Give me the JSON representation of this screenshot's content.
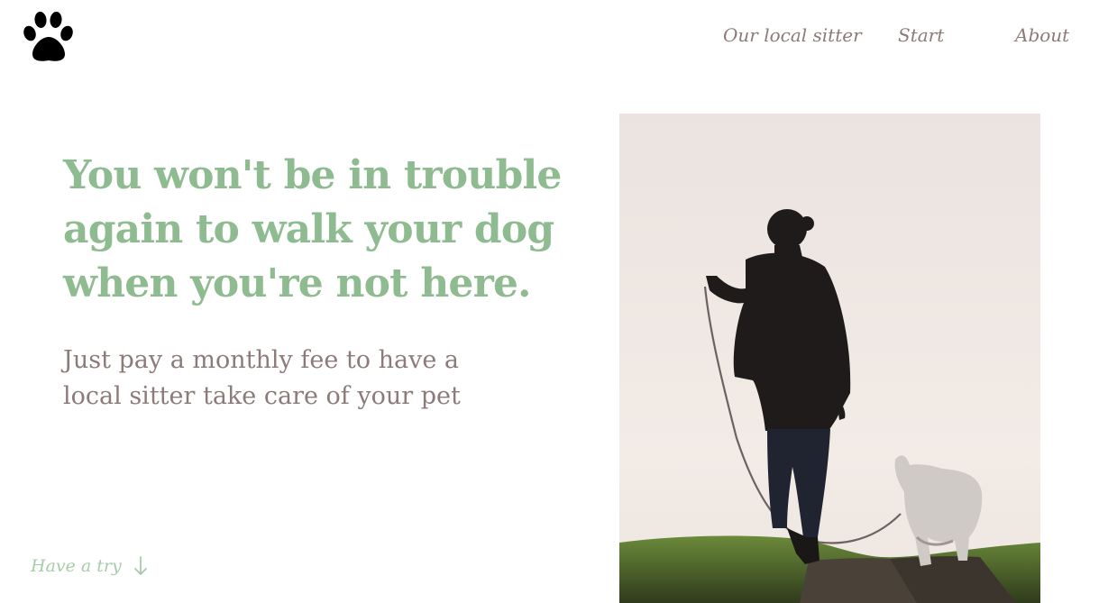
{
  "brand": {
    "logo_icon": "paw-icon",
    "logo_color": "#000000"
  },
  "nav": {
    "items": [
      {
        "label": "Our local sitter"
      },
      {
        "label": "Start"
      },
      {
        "label": "About"
      }
    ]
  },
  "hero": {
    "headline": "You won't be in trouble again to walk your dog when you're not here.",
    "subtitle": "Just pay a monthly fee to have a local sitter take care of your pet",
    "cta": {
      "label": "Have a try",
      "icon": "arrow-down-icon"
    },
    "image": {
      "subject": "woman walking a dog on a leash at sunset"
    }
  },
  "colors": {
    "accent": "#8fbb91",
    "accent_light": "#a8ccaa",
    "text_muted": "#8c7b78",
    "background": "#ffffff"
  }
}
